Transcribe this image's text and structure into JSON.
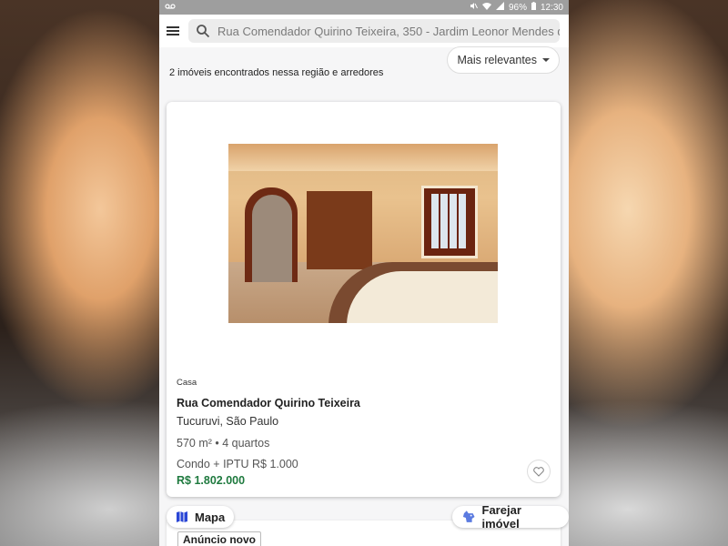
{
  "status_bar": {
    "left_icon": "voicemail-icon",
    "battery": "96%",
    "time": "12:30"
  },
  "search": {
    "value": "Rua Comendador Quirino Teixeira, 350 - Jardim Leonor Mendes d..."
  },
  "results": {
    "count_text": "2 imóveis encontrados nessa região e arredores",
    "sort_label": "Mais relevantes"
  },
  "listing": {
    "type": "Casa",
    "street": "Rua Comendador Quirino Teixeira",
    "city": "Tucuruvi, São Paulo",
    "area_rooms": "570 m² • 4 quartos",
    "fees": "Condo + IPTU R$ 1.000",
    "price": "R$ 1.802.000",
    "price_color": "#1f7a3f"
  },
  "bottom": {
    "map_label": "Mapa",
    "sniff_label": "Farejar imóvel",
    "badge": "Anúncio novo"
  }
}
